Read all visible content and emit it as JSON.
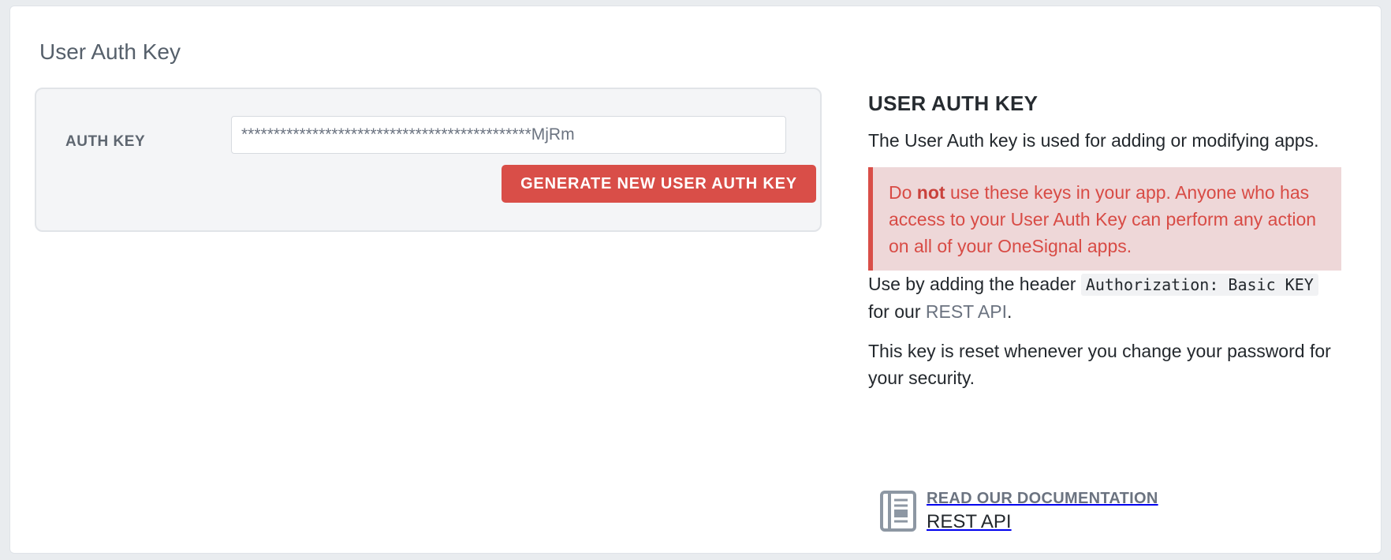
{
  "section": {
    "title": "User Auth Key"
  },
  "form": {
    "label": "AUTH KEY",
    "value": "*********************************************MjRm",
    "button_label": "GENERATE NEW USER AUTH KEY"
  },
  "sidebar": {
    "heading": "USER AUTH KEY",
    "intro": "The User Auth key is used for adding or modifying apps.",
    "alert": {
      "prefix": "Do ",
      "emphasis": "not",
      "suffix": " use these keys in your app. Anyone who has access to your User Auth Key can perform any action on all of your OneSignal apps."
    },
    "usage": {
      "prefix": "Use by adding the header ",
      "code": "Authorization: Basic KEY",
      "middle": " for our ",
      "link": "REST API",
      "suffix": "."
    },
    "reset_note": "This key is reset whenever you change your password for your security.",
    "docs": {
      "eyebrow": "READ OUR DOCUMENTATION",
      "title": "REST API",
      "icon": "documentation-book-icon"
    }
  },
  "colors": {
    "danger": "#d94e48",
    "alert_bg": "#eed7d8",
    "panel_bg": "#f4f5f7"
  }
}
